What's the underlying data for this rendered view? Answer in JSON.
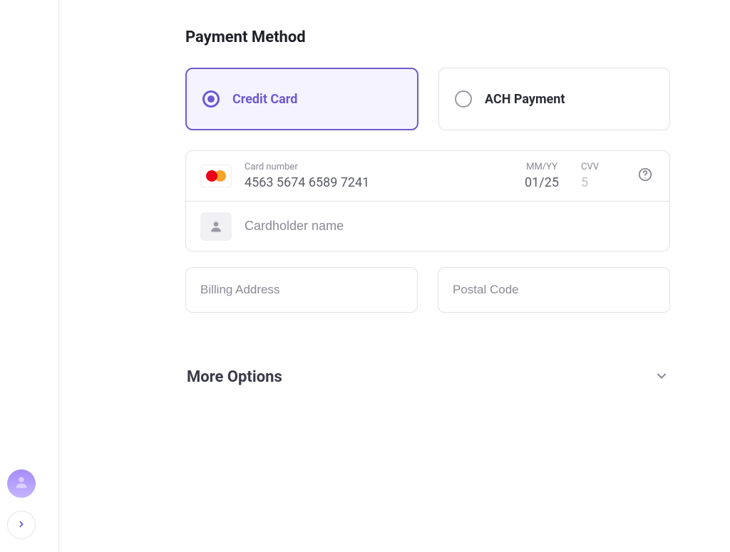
{
  "colors": {
    "accent": "#6d5bd0",
    "accent_light": "#f5f3ff",
    "border": "#e1e1e6",
    "text_dark": "#1f2028",
    "text_muted": "#8a8a94"
  },
  "section_title": "Payment Method",
  "payment_methods": {
    "credit_card": {
      "label": "Credit Card",
      "selected": true
    },
    "ach": {
      "label": "ACH Payment",
      "selected": false
    }
  },
  "card": {
    "brand": "mastercard",
    "number_label": "Card number",
    "number_value": "4563 5674 6589 7241",
    "expiry_label": "MM/YY",
    "expiry_value": "01/25",
    "cvv_label": "CVV",
    "cvv_value": "5",
    "cardholder_placeholder": "Cardholder name"
  },
  "address": {
    "billing_placeholder": "Billing Address",
    "postal_placeholder": "Postal Code"
  },
  "more_options_label": "More Options",
  "icons": {
    "avatar": "person-icon",
    "nav_arrow": "chevron-right-icon",
    "help": "help-circle-icon",
    "chevron_down": "chevron-down-icon",
    "cardholder": "person-icon"
  }
}
